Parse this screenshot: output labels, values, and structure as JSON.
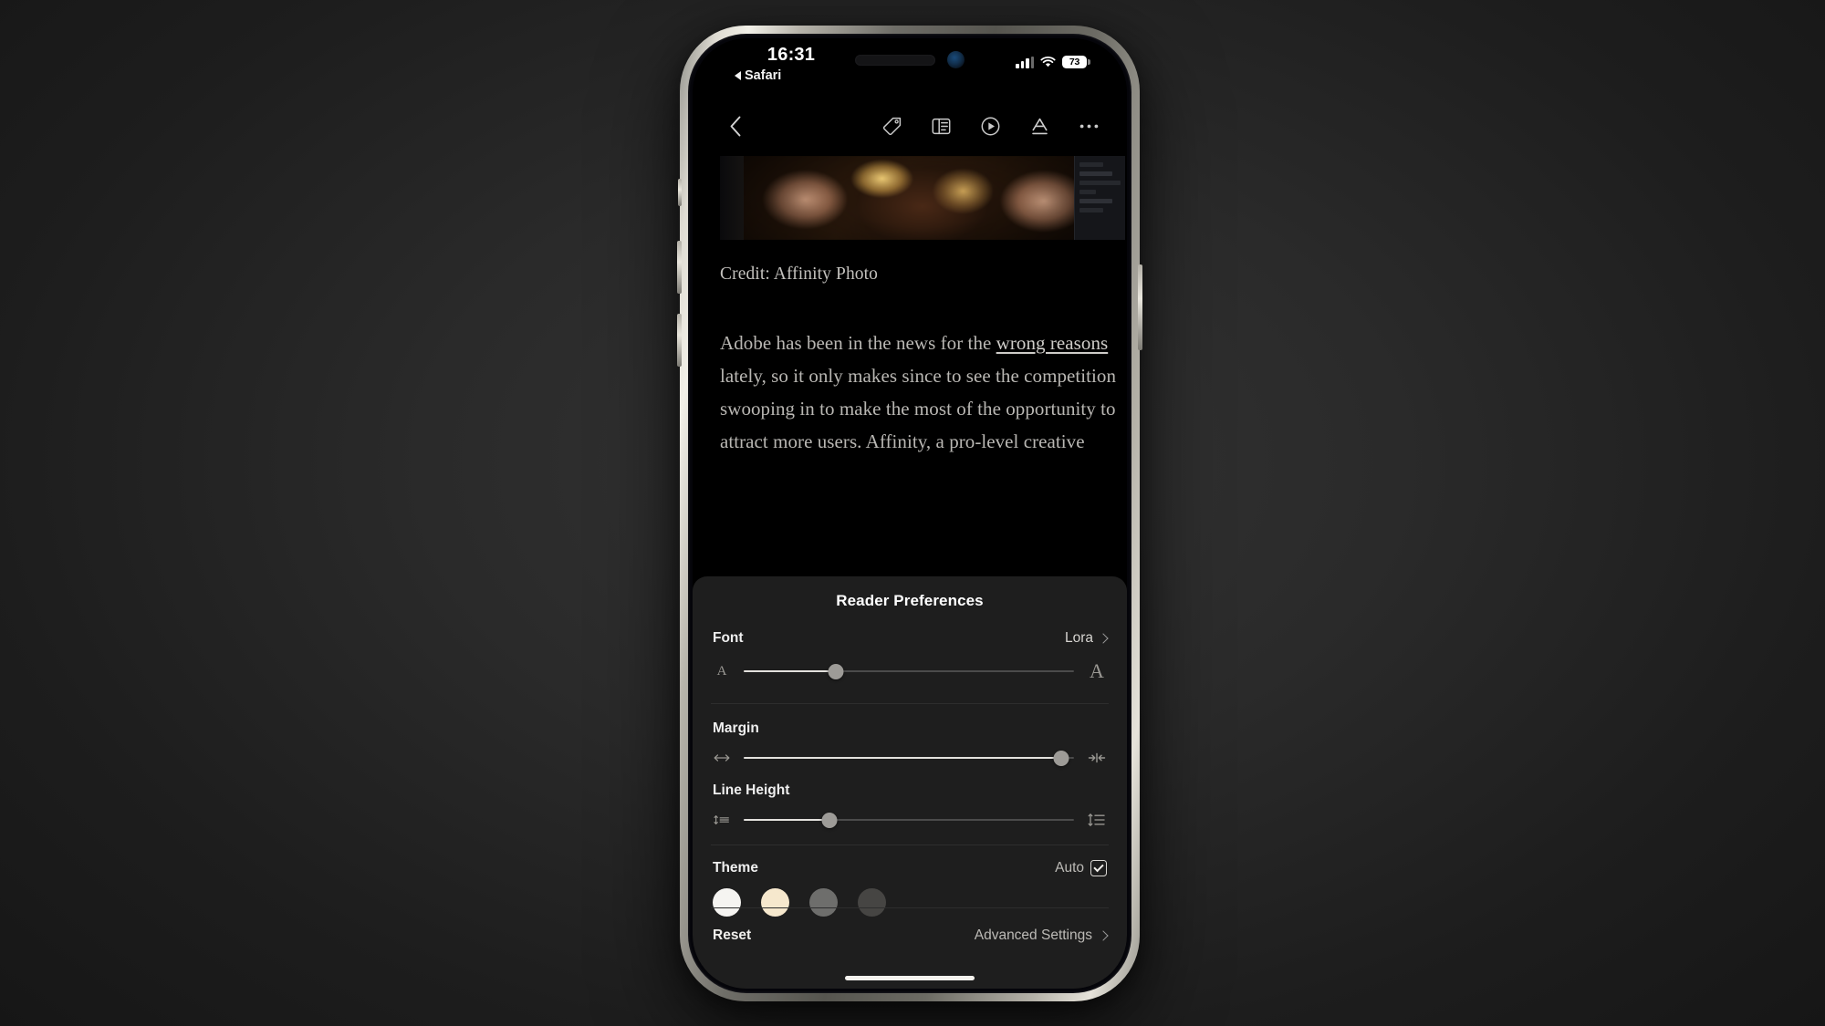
{
  "status_bar": {
    "time": "16:31",
    "back_app": "Safari",
    "back_icon": "triangle-left-icon",
    "signal_icon": "cellular-signal-icon",
    "wifi_icon": "wifi-icon",
    "battery_percent": "73",
    "dynamic_island": "dynamic-island"
  },
  "toolbar": {
    "back_icon": "chevron-left-icon",
    "items": [
      {
        "name": "tag-icon",
        "label": "Tag"
      },
      {
        "name": "reader-view-icon",
        "label": "Reader View"
      },
      {
        "name": "play-circle-icon",
        "label": "Listen"
      },
      {
        "name": "text-format-icon",
        "label": "Text Format"
      },
      {
        "name": "more-options-icon",
        "label": "More"
      }
    ]
  },
  "article": {
    "image_caption": "Credit: Affinity Photo",
    "body_before_link": "Adobe has been in the news for the ",
    "link_text": "wrong reasons",
    "body_after_link": " lately, so it only makes since to see the competition swooping in to make the most of the opportunity to attract more users. Affinity, a pro-level creative"
  },
  "sheet": {
    "title": "Reader Preferences",
    "font": {
      "label": "Font",
      "value": "Lora",
      "chevron_icon": "chevron-right-icon",
      "slider": {
        "name": "font-size-slider",
        "percent": 28,
        "min_icon": "small-a-icon",
        "min_label": "A",
        "max_icon": "large-a-icon",
        "max_label": "A"
      }
    },
    "margin": {
      "label": "Margin",
      "slider": {
        "name": "margin-slider",
        "percent": 96,
        "min_icon": "wide-margin-icon",
        "max_icon": "narrow-margin-icon"
      }
    },
    "line_height": {
      "label": "Line Height",
      "slider": {
        "name": "line-height-slider",
        "percent": 26,
        "min_icon": "line-height-small-icon",
        "max_icon": "line-height-large-icon"
      }
    },
    "theme": {
      "label": "Theme",
      "auto_label": "Auto",
      "auto_checked": true,
      "swatches": [
        {
          "name": "theme-light",
          "color": "#f5f4f1"
        },
        {
          "name": "theme-sepia",
          "color": "#f6e8cd"
        },
        {
          "name": "theme-gray",
          "color": "#6e6e6c"
        },
        {
          "name": "theme-dark",
          "color": "#464543"
        }
      ]
    },
    "footer": {
      "reset_label": "Reset",
      "advanced_label": "Advanced Settings",
      "advanced_chevron_icon": "chevron-right-icon"
    }
  }
}
